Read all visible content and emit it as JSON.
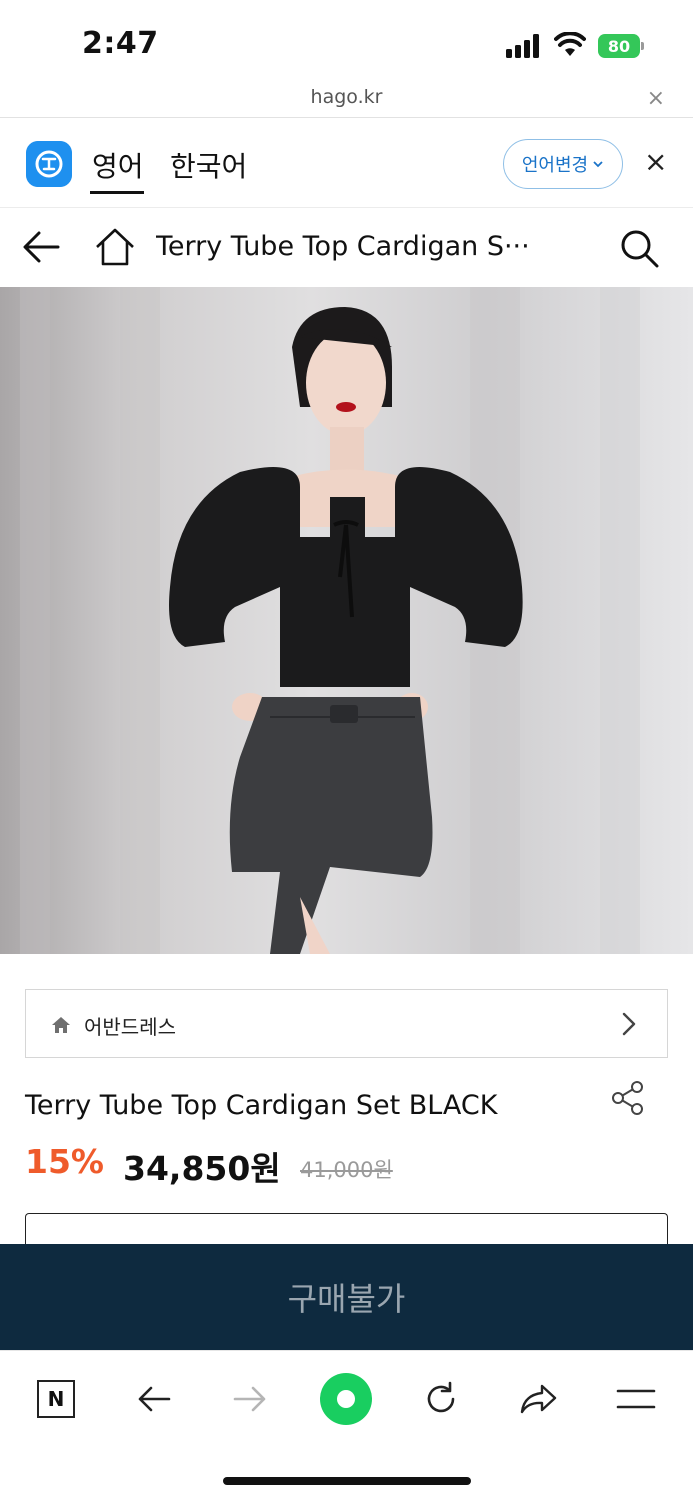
{
  "status_bar": {
    "time": "2:47",
    "battery": "80"
  },
  "url_bar": {
    "url": "hago.kr",
    "close_glyph": "×"
  },
  "translate_bar": {
    "tabs": [
      {
        "label": "영어",
        "active": true
      },
      {
        "label": "한국어",
        "active": false
      }
    ],
    "language_change_label": "언어변경",
    "close_glyph": "×"
  },
  "header": {
    "title": "Terry Tube Top Cardigan S···"
  },
  "breadcrumb": {
    "label": "어반드레스"
  },
  "product": {
    "name": "Terry Tube Top Cardigan Set BLACK",
    "discount": "15%",
    "price": "34,850원",
    "original_price": "41,000원"
  },
  "buy_button": {
    "label": "구매불가"
  },
  "toolbar": {
    "items": [
      "naver-home-icon",
      "back-arrow-icon",
      "forward-arrow-icon",
      "green-dot-icon",
      "refresh-icon",
      "share-icon",
      "menu-icon"
    ],
    "naver_letter": "N"
  },
  "colors": {
    "accent_discount": "#ef5b2b",
    "buy_bar": "#0e2a3f",
    "battery": "#34c759",
    "translate_accent": "#1a73c8",
    "green_button": "#19ce60"
  }
}
